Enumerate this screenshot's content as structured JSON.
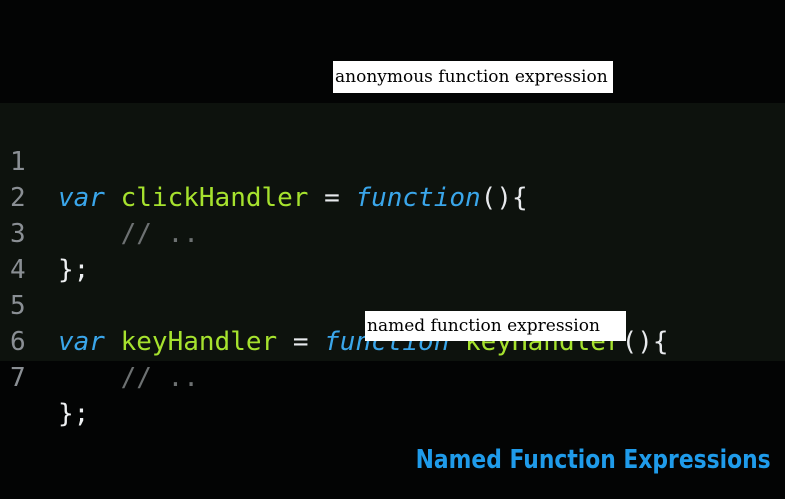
{
  "slide": {
    "title": "Named Function Expressions"
  },
  "annotations": {
    "anonymous": "anonymous  function  expression",
    "named": "named  function  expression"
  },
  "code": {
    "lines": [
      {
        "number": "1",
        "tokens": [
          "var",
          " ",
          "clickHandler",
          " = ",
          "function",
          "(){"
        ]
      },
      {
        "number": "2",
        "tokens": [
          "    // .."
        ]
      },
      {
        "number": "3",
        "tokens": [
          "};"
        ]
      },
      {
        "number": "4",
        "tokens": [
          ""
        ]
      },
      {
        "number": "5",
        "tokens": [
          "var",
          " ",
          "keyHandler",
          " = ",
          "function",
          " ",
          "keyHandler",
          "(){"
        ]
      },
      {
        "number": "6",
        "tokens": [
          "    // .."
        ]
      },
      {
        "number": "7",
        "tokens": [
          "};"
        ]
      }
    ]
  },
  "colors": {
    "keyword": "#3aa6ea",
    "identifier": "#a6e22e",
    "comment": "#6d7172",
    "title": "#1f9bea"
  }
}
